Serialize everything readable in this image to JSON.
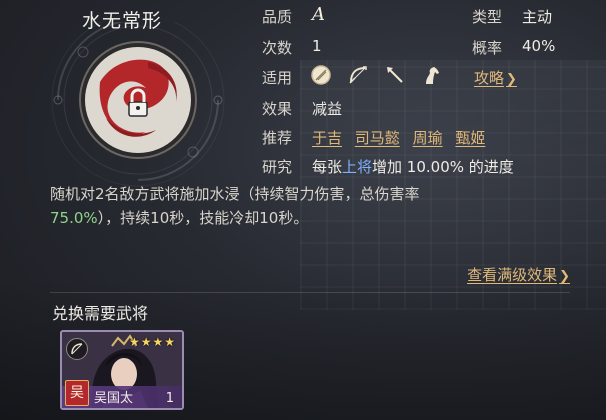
{
  "skill": {
    "name": "水无常形",
    "emblem_icon": "water-swirl-lock-icon"
  },
  "stats": {
    "quality_label": "品质",
    "quality_value": "A",
    "type_label": "类型",
    "type_value": "主动",
    "count_label": "次数",
    "count_value": "1",
    "rate_label": "概率",
    "rate_value": "40%",
    "applicable_label": "适用",
    "applicable_icons": [
      "shield-icon",
      "bow-icon",
      "spear-icon",
      "horse-icon"
    ],
    "strategy_link": "攻略",
    "effect_label": "效果",
    "effect_value": "减益",
    "recommend_label": "推荐",
    "recommend": [
      "于吉",
      "司马懿",
      "周瑜",
      "甄姬"
    ],
    "research_label": "研究",
    "research_text": {
      "prefix": "每张",
      "highlight": "上将",
      "suffix": "增加 10.00% 的进度"
    }
  },
  "description": {
    "line1": "随机对2名敌方武将施加水浸（持续智力伤害，总伤害率",
    "rate": "75.0%",
    "line2": "），持续10秒，技能冷却10秒。"
  },
  "full_effect_link": "查看满级效果",
  "exchange": {
    "title": "兑换需要武将",
    "general": {
      "name": "吴国太",
      "faction": "吴",
      "stars": "★★★★",
      "count": "1",
      "troop_icon": "bow-icon"
    }
  },
  "colors": {
    "gold_link": "#e0b87a",
    "highlight_blue": "#7fb0ff",
    "highlight_green": "#8fd48a",
    "faction_red": "#b2282c"
  }
}
